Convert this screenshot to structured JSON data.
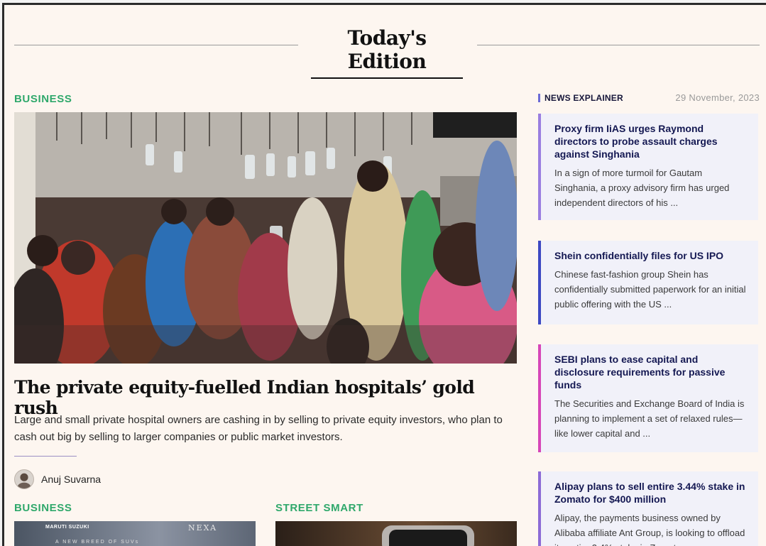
{
  "edition": {
    "title": "Today's Edition"
  },
  "main": {
    "section": "BUSINESS",
    "headline": "The private equity-fuelled Indian hospitals’ gold rush",
    "summary": "Large and small private hospital owners are cashing in by selling to private equity investors, who plan to cash out big by selling to larger companies or public market investors.",
    "author": "Anuj Suvarna"
  },
  "sub_articles": [
    {
      "section": "BUSINESS",
      "brand": "MARUTI SUZUKI",
      "nexa": "NEXA",
      "strap": "A NEW BREED OF SUVs"
    },
    {
      "section": "STREET SMART"
    }
  ],
  "sidebar": {
    "label": "NEWS EXPLAINER",
    "date": "29 November, 2023",
    "cards": [
      {
        "title": "Proxy firm IiAS urges Raymond directors to probe assault charges against Singhania",
        "text": "In a sign of more turmoil for Gautam Singhania, a proxy advisory firm has urged independent directors of his ..."
      },
      {
        "title": "Shein confidentially files for US IPO",
        "text": "Chinese fast-fashion group Shein has confidentially submitted paperwork for an initial public offering with the US ..."
      },
      {
        "title": "SEBI plans to ease capital and disclosure requirements for passive funds",
        "text": "The Securities and Exchange Board of India is planning to implement a set of relaxed rules—like lower capital and ..."
      },
      {
        "title": "Alipay plans to sell entire 3.44% stake in Zomato for $400 million",
        "text": "Alipay, the payments business owned by Alibaba affiliate Ant Group, is looking to offload its entire 3.4% stake in Zomato ..."
      }
    ]
  }
}
